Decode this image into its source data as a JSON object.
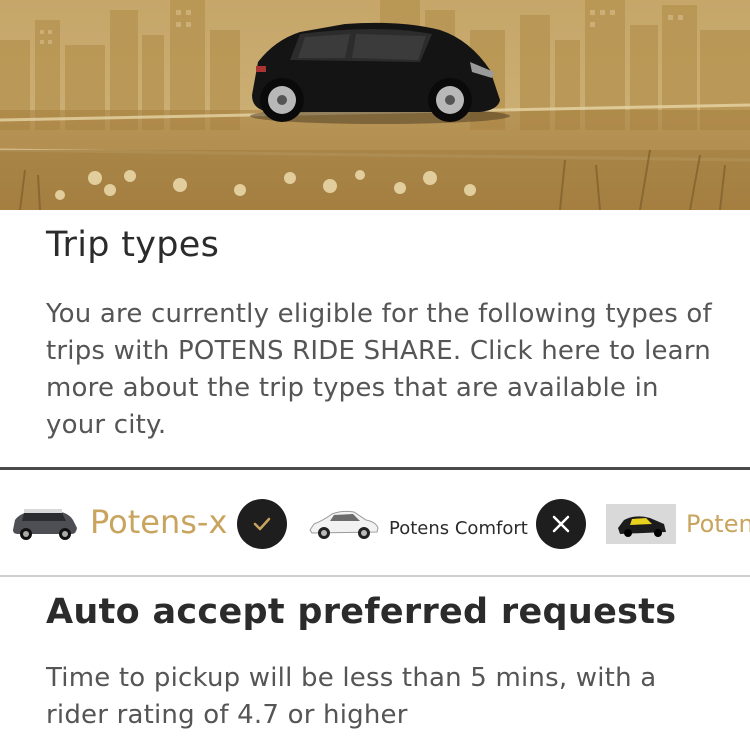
{
  "hero": {
    "image": "car-city-banner"
  },
  "trip_types": {
    "heading": "Trip types",
    "description": "You are currently eligible for the following types of trips with POTENS RIDE SHARE. Click here to learn more about the trip types that are available in your city."
  },
  "types": [
    {
      "label": "Potens-x",
      "status": "selected",
      "status_icon": "check-icon",
      "label_color": "#c8a45e"
    },
    {
      "label": "Potens Comfort",
      "status": "not-selected",
      "status_icon": "close-icon",
      "label_color": "#2b2b2b"
    },
    {
      "label": "Poten",
      "status": "partial-visible",
      "label_color": "#c8a45e"
    }
  ],
  "auto_accept": {
    "heading": "Auto accept preferred requests",
    "description": "Time to pickup will be less than 5 mins, with a rider rating of 4.7 or higher"
  },
  "colors": {
    "accent": "#c8a45e",
    "dark": "#1e1e1e",
    "divider": "#4a4a4a"
  }
}
